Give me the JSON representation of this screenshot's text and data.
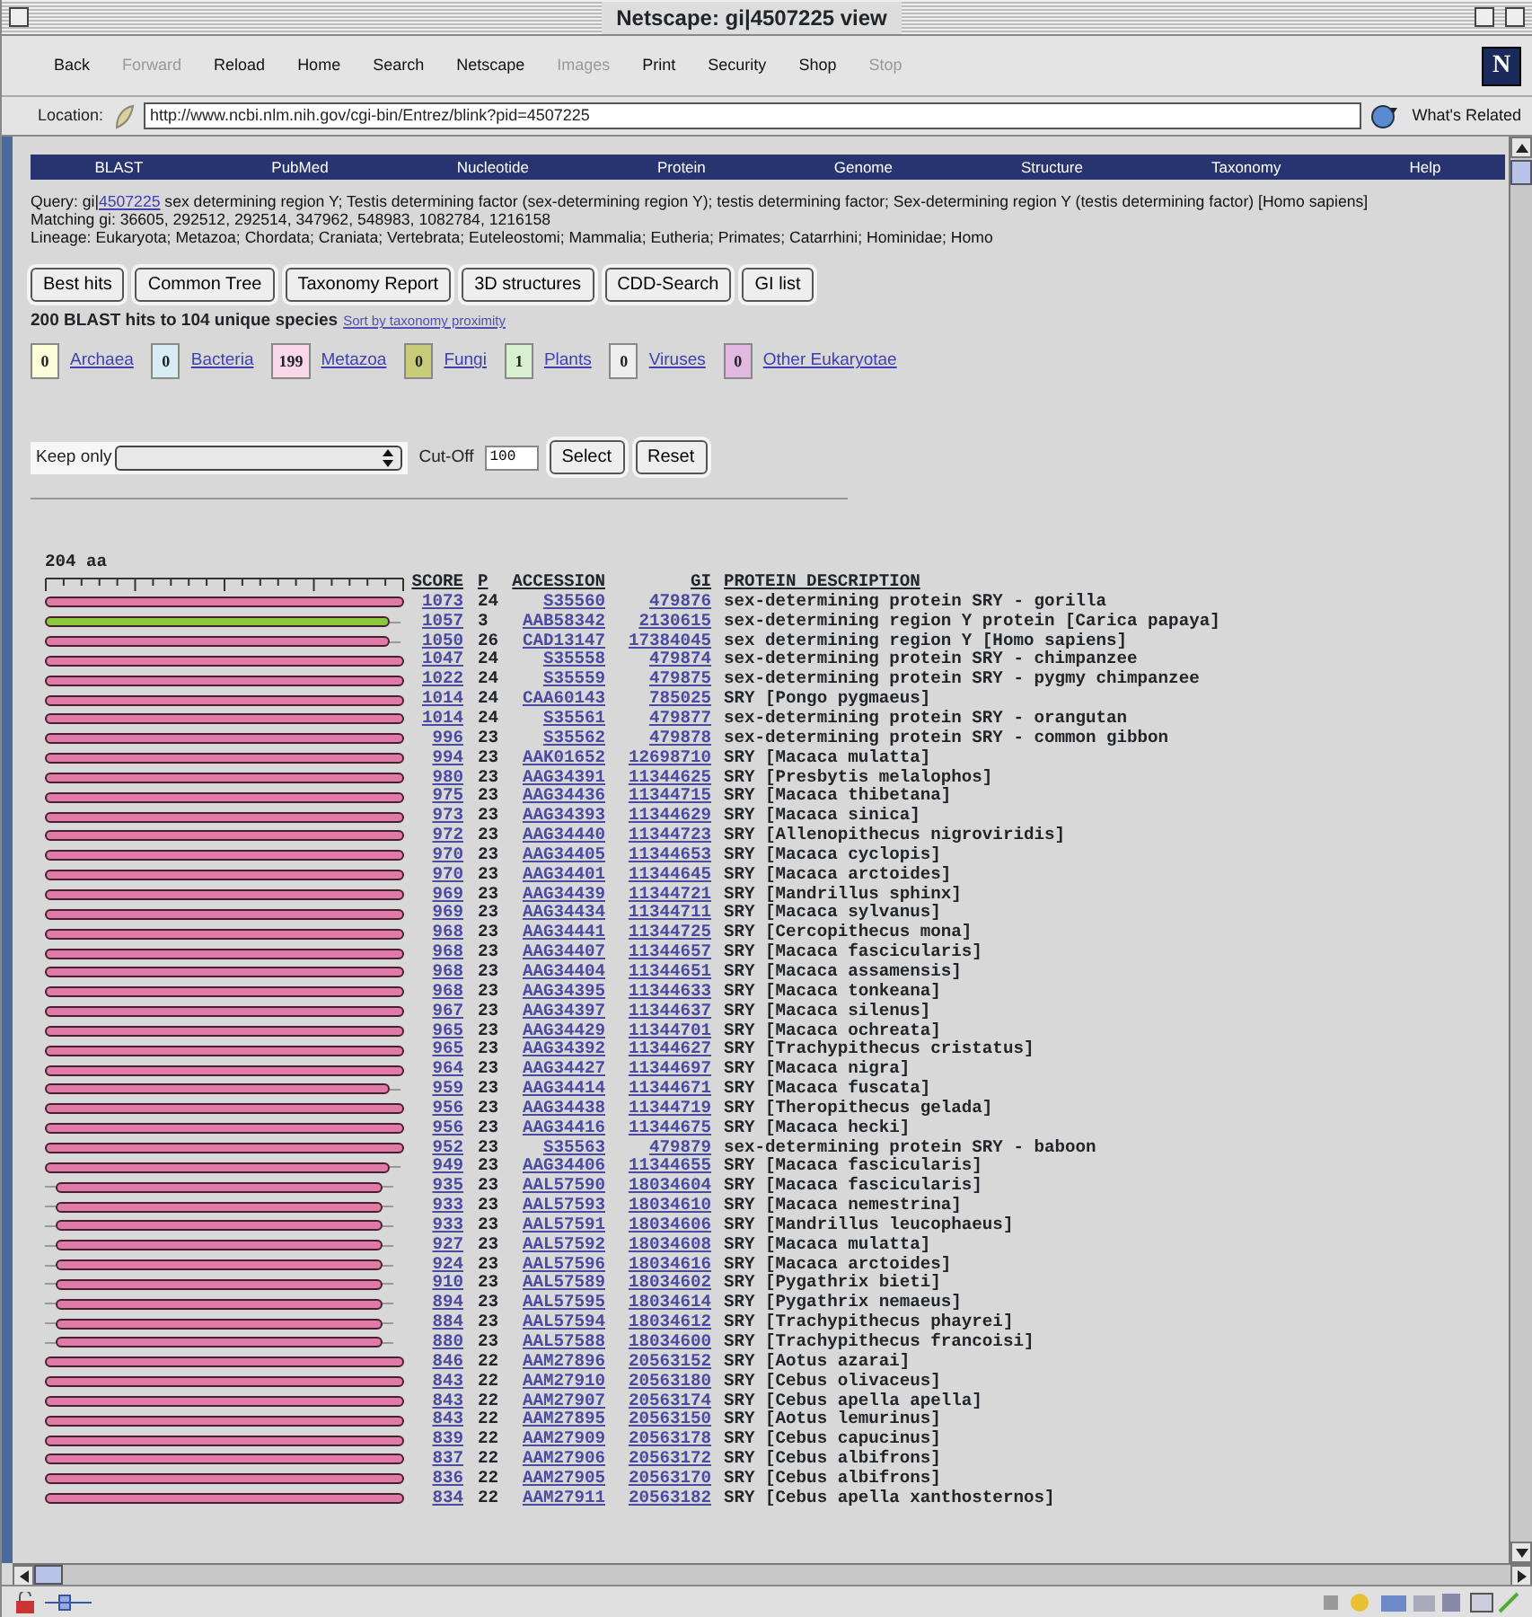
{
  "window": {
    "title": "Netscape: gi|4507225 view"
  },
  "toolbar": [
    {
      "label": "Back",
      "disabled": false
    },
    {
      "label": "Forward",
      "disabled": true
    },
    {
      "label": "Reload",
      "disabled": false
    },
    {
      "label": "Home",
      "disabled": false
    },
    {
      "label": "Search",
      "disabled": false
    },
    {
      "label": "Netscape",
      "disabled": false
    },
    {
      "label": "Images",
      "disabled": true
    },
    {
      "label": "Print",
      "disabled": false
    },
    {
      "label": "Security",
      "disabled": false
    },
    {
      "label": "Shop",
      "disabled": false
    },
    {
      "label": "Stop",
      "disabled": true
    }
  ],
  "logo": "N",
  "location": {
    "label": "Location:",
    "url": "http://www.ncbi.nlm.nih.gov/cgi-bin/Entrez/blink?pid=4507225",
    "related": "What's Related"
  },
  "nav": [
    "BLAST",
    "PubMed",
    "Nucleotide",
    "Protein",
    "Genome",
    "Structure",
    "Taxonomy",
    "Help"
  ],
  "query": {
    "prefix": "Query: gi|",
    "link": "4507225",
    "rest": " sex determining region Y; Testis determining factor (sex-determining region Y); testis determining factor; Sex-determining region Y (testis determining factor) [Homo sapiens]",
    "matching": "Matching gi: 36605, 292512, 292514, 347962, 548983, 1082784, 1216158",
    "lineage": "Lineage: Eukaryota; Metazoa; Chordata; Craniata; Vertebrata; Euteleostomi; Mammalia; Eutheria; Primates; Catarrhini; Hominidae; Homo"
  },
  "buttons": [
    "Best hits",
    "Common Tree",
    "Taxonomy Report",
    "3D structures",
    "CDD-Search",
    "GI list"
  ],
  "summary": {
    "text": "200 BLAST hits to 104 unique species",
    "link": "Sort by taxonomy proximity"
  },
  "groups": [
    {
      "count": "0",
      "label": "Archaea",
      "color": "#fcfcd8"
    },
    {
      "count": "0",
      "label": "Bacteria",
      "color": "#d8ecf4"
    },
    {
      "count": "199",
      "label": "Metazoa",
      "color": "#f8d8e8"
    },
    {
      "count": "0",
      "label": "Fungi",
      "color": "#c8cc78"
    },
    {
      "count": "1",
      "label": "Plants",
      "color": "#d8f0d0"
    },
    {
      "count": "0",
      "label": "Viruses",
      "color": "#eeeeee"
    },
    {
      "count": "0",
      "label": "Other Eukaryotae",
      "color": "#e0b8e0"
    }
  ],
  "filter": {
    "label": "Keep only",
    "cutoff_label": "Cut-Off",
    "cutoff": "100",
    "buttons": [
      "Select",
      "Reset"
    ]
  },
  "ruler": {
    "label": "204 aa"
  },
  "columns": [
    "SCORE",
    "P",
    "ACCESSION",
    "GI",
    "PROTEIN DESCRIPTION"
  ],
  "hits": [
    {
      "score": "1073",
      "p": "24",
      "accession": "S35560",
      "gi": "479876",
      "description": "sex-determining protein SRY - gorilla",
      "color": "#e07aa8",
      "kind": "full"
    },
    {
      "score": "1057",
      "p": "3",
      "accession": "AAB58342",
      "gi": "2130615",
      "description": "sex-determining region Y protein [Carica papaya]",
      "color": "#8cc83c",
      "kind": "short"
    },
    {
      "score": "1050",
      "p": "26",
      "accession": "CAD13147",
      "gi": "17384045",
      "description": "sex determining region Y [Homo sapiens]",
      "color": "#e07aa8",
      "kind": "short"
    },
    {
      "score": "1047",
      "p": "24",
      "accession": "S35558",
      "gi": "479874",
      "description": "sex-determining protein SRY - chimpanzee",
      "color": "#e07aa8",
      "kind": "full"
    },
    {
      "score": "1022",
      "p": "24",
      "accession": "S35559",
      "gi": "479875",
      "description": "sex-determining protein SRY - pygmy chimpanzee",
      "color": "#e07aa8",
      "kind": "full"
    },
    {
      "score": "1014",
      "p": "24",
      "accession": "CAA60143",
      "gi": "785025",
      "description": "SRY [Pongo pygmaeus]",
      "color": "#e07aa8",
      "kind": "full"
    },
    {
      "score": "1014",
      "p": "24",
      "accession": "S35561",
      "gi": "479877",
      "description": "sex-determining protein SRY - orangutan",
      "color": "#e07aa8",
      "kind": "full"
    },
    {
      "score": "996",
      "p": "23",
      "accession": "S35562",
      "gi": "479878",
      "description": "sex-determining protein SRY - common gibbon",
      "color": "#e07aa8",
      "kind": "full"
    },
    {
      "score": "994",
      "p": "23",
      "accession": "AAK01652",
      "gi": "12698710",
      "description": "SRY [Macaca mulatta]",
      "color": "#e07aa8",
      "kind": "full"
    },
    {
      "score": "980",
      "p": "23",
      "accession": "AAG34391",
      "gi": "11344625",
      "description": "SRY [Presbytis melalophos]",
      "color": "#e07aa8",
      "kind": "full"
    },
    {
      "score": "975",
      "p": "23",
      "accession": "AAG34436",
      "gi": "11344715",
      "description": "SRY [Macaca thibetana]",
      "color": "#e07aa8",
      "kind": "full"
    },
    {
      "score": "973",
      "p": "23",
      "accession": "AAG34393",
      "gi": "11344629",
      "description": "SRY [Macaca sinica]",
      "color": "#e07aa8",
      "kind": "full"
    },
    {
      "score": "972",
      "p": "23",
      "accession": "AAG34440",
      "gi": "11344723",
      "description": "SRY [Allenopithecus nigroviridis]",
      "color": "#e07aa8",
      "kind": "full"
    },
    {
      "score": "970",
      "p": "23",
      "accession": "AAG34405",
      "gi": "11344653",
      "description": "SRY [Macaca cyclopis]",
      "color": "#e07aa8",
      "kind": "full"
    },
    {
      "score": "970",
      "p": "23",
      "accession": "AAG34401",
      "gi": "11344645",
      "description": "SRY [Macaca arctoides]",
      "color": "#e07aa8",
      "kind": "full"
    },
    {
      "score": "969",
      "p": "23",
      "accession": "AAG34439",
      "gi": "11344721",
      "description": "SRY [Mandrillus sphinx]",
      "color": "#e07aa8",
      "kind": "full"
    },
    {
      "score": "969",
      "p": "23",
      "accession": "AAG34434",
      "gi": "11344711",
      "description": "SRY [Macaca sylvanus]",
      "color": "#e07aa8",
      "kind": "full"
    },
    {
      "score": "968",
      "p": "23",
      "accession": "AAG34441",
      "gi": "11344725",
      "description": "SRY [Cercopithecus mona]",
      "color": "#e07aa8",
      "kind": "full"
    },
    {
      "score": "968",
      "p": "23",
      "accession": "AAG34407",
      "gi": "11344657",
      "description": "SRY [Macaca fascicularis]",
      "color": "#e07aa8",
      "kind": "full"
    },
    {
      "score": "968",
      "p": "23",
      "accession": "AAG34404",
      "gi": "11344651",
      "description": "SRY [Macaca assamensis]",
      "color": "#e07aa8",
      "kind": "full"
    },
    {
      "score": "968",
      "p": "23",
      "accession": "AAG34395",
      "gi": "11344633",
      "description": "SRY [Macaca tonkeana]",
      "color": "#e07aa8",
      "kind": "full"
    },
    {
      "score": "967",
      "p": "23",
      "accession": "AAG34397",
      "gi": "11344637",
      "description": "SRY [Macaca silenus]",
      "color": "#e07aa8",
      "kind": "full"
    },
    {
      "score": "965",
      "p": "23",
      "accession": "AAG34429",
      "gi": "11344701",
      "description": "SRY [Macaca ochreata]",
      "color": "#e07aa8",
      "kind": "full"
    },
    {
      "score": "965",
      "p": "23",
      "accession": "AAG34392",
      "gi": "11344627",
      "description": "SRY [Trachypithecus cristatus]",
      "color": "#e07aa8",
      "kind": "full"
    },
    {
      "score": "964",
      "p": "23",
      "accession": "AAG34427",
      "gi": "11344697",
      "description": "SRY [Macaca nigra]",
      "color": "#e07aa8",
      "kind": "full"
    },
    {
      "score": "959",
      "p": "23",
      "accession": "AAG34414",
      "gi": "11344671",
      "description": "SRY [Macaca fuscata]",
      "color": "#e07aa8",
      "kind": "short"
    },
    {
      "score": "956",
      "p": "23",
      "accession": "AAG34438",
      "gi": "11344719",
      "description": "SRY [Theropithecus gelada]",
      "color": "#e07aa8",
      "kind": "full"
    },
    {
      "score": "956",
      "p": "23",
      "accession": "AAG34416",
      "gi": "11344675",
      "description": "SRY [Macaca hecki]",
      "color": "#e07aa8",
      "kind": "full"
    },
    {
      "score": "952",
      "p": "23",
      "accession": "S35563",
      "gi": "479879",
      "description": "sex-determining protein SRY - baboon",
      "color": "#e07aa8",
      "kind": "full"
    },
    {
      "score": "949",
      "p": "23",
      "accession": "AAG34406",
      "gi": "11344655",
      "description": "SRY [Macaca fascicularis]",
      "color": "#e07aa8",
      "kind": "short"
    },
    {
      "score": "935",
      "p": "23",
      "accession": "AAL57590",
      "gi": "18034604",
      "description": "SRY [Macaca fascicularis]",
      "color": "#e07aa8",
      "kind": "inset"
    },
    {
      "score": "933",
      "p": "23",
      "accession": "AAL57593",
      "gi": "18034610",
      "description": "SRY [Macaca nemestrina]",
      "color": "#e07aa8",
      "kind": "inset"
    },
    {
      "score": "933",
      "p": "23",
      "accession": "AAL57591",
      "gi": "18034606",
      "description": "SRY [Mandrillus leucophaeus]",
      "color": "#e07aa8",
      "kind": "inset"
    },
    {
      "score": "927",
      "p": "23",
      "accession": "AAL57592",
      "gi": "18034608",
      "description": "SRY [Macaca mulatta]",
      "color": "#e07aa8",
      "kind": "inset"
    },
    {
      "score": "924",
      "p": "23",
      "accession": "AAL57596",
      "gi": "18034616",
      "description": "SRY [Macaca arctoides]",
      "color": "#e07aa8",
      "kind": "inset"
    },
    {
      "score": "910",
      "p": "23",
      "accession": "AAL57589",
      "gi": "18034602",
      "description": "SRY [Pygathrix bieti]",
      "color": "#e07aa8",
      "kind": "inset"
    },
    {
      "score": "894",
      "p": "23",
      "accession": "AAL57595",
      "gi": "18034614",
      "description": "SRY [Pygathrix nemaeus]",
      "color": "#e07aa8",
      "kind": "inset"
    },
    {
      "score": "884",
      "p": "23",
      "accession": "AAL57594",
      "gi": "18034612",
      "description": "SRY [Trachypithecus phayrei]",
      "color": "#e07aa8",
      "kind": "inset"
    },
    {
      "score": "880",
      "p": "23",
      "accession": "AAL57588",
      "gi": "18034600",
      "description": "SRY [Trachypithecus francoisi]",
      "color": "#e07aa8",
      "kind": "inset"
    },
    {
      "score": "846",
      "p": "22",
      "accession": "AAM27896",
      "gi": "20563152",
      "description": "SRY [Aotus azarai]",
      "color": "#e07aa8",
      "kind": "full"
    },
    {
      "score": "843",
      "p": "22",
      "accession": "AAM27910",
      "gi": "20563180",
      "description": "SRY [Cebus olivaceus]",
      "color": "#e07aa8",
      "kind": "full"
    },
    {
      "score": "843",
      "p": "22",
      "accession": "AAM27907",
      "gi": "20563174",
      "description": "SRY [Cebus apella apella]",
      "color": "#e07aa8",
      "kind": "full"
    },
    {
      "score": "843",
      "p": "22",
      "accession": "AAM27895",
      "gi": "20563150",
      "description": "SRY [Aotus lemurinus]",
      "color": "#e07aa8",
      "kind": "full"
    },
    {
      "score": "839",
      "p": "22",
      "accession": "AAM27909",
      "gi": "20563178",
      "description": "SRY [Cebus capucinus]",
      "color": "#e07aa8",
      "kind": "full"
    },
    {
      "score": "837",
      "p": "22",
      "accession": "AAM27906",
      "gi": "20563172",
      "description": "SRY [Cebus albifrons]",
      "color": "#e07aa8",
      "kind": "full"
    },
    {
      "score": "836",
      "p": "22",
      "accession": "AAM27905",
      "gi": "20563170",
      "description": "SRY [Cebus albifrons]",
      "color": "#e07aa8",
      "kind": "full"
    },
    {
      "score": "834",
      "p": "22",
      "accession": "AAM27911",
      "gi": "20563182",
      "description": "SRY [Cebus apella xanthosternos]",
      "color": "#e07aa8",
      "kind": "full"
    }
  ]
}
